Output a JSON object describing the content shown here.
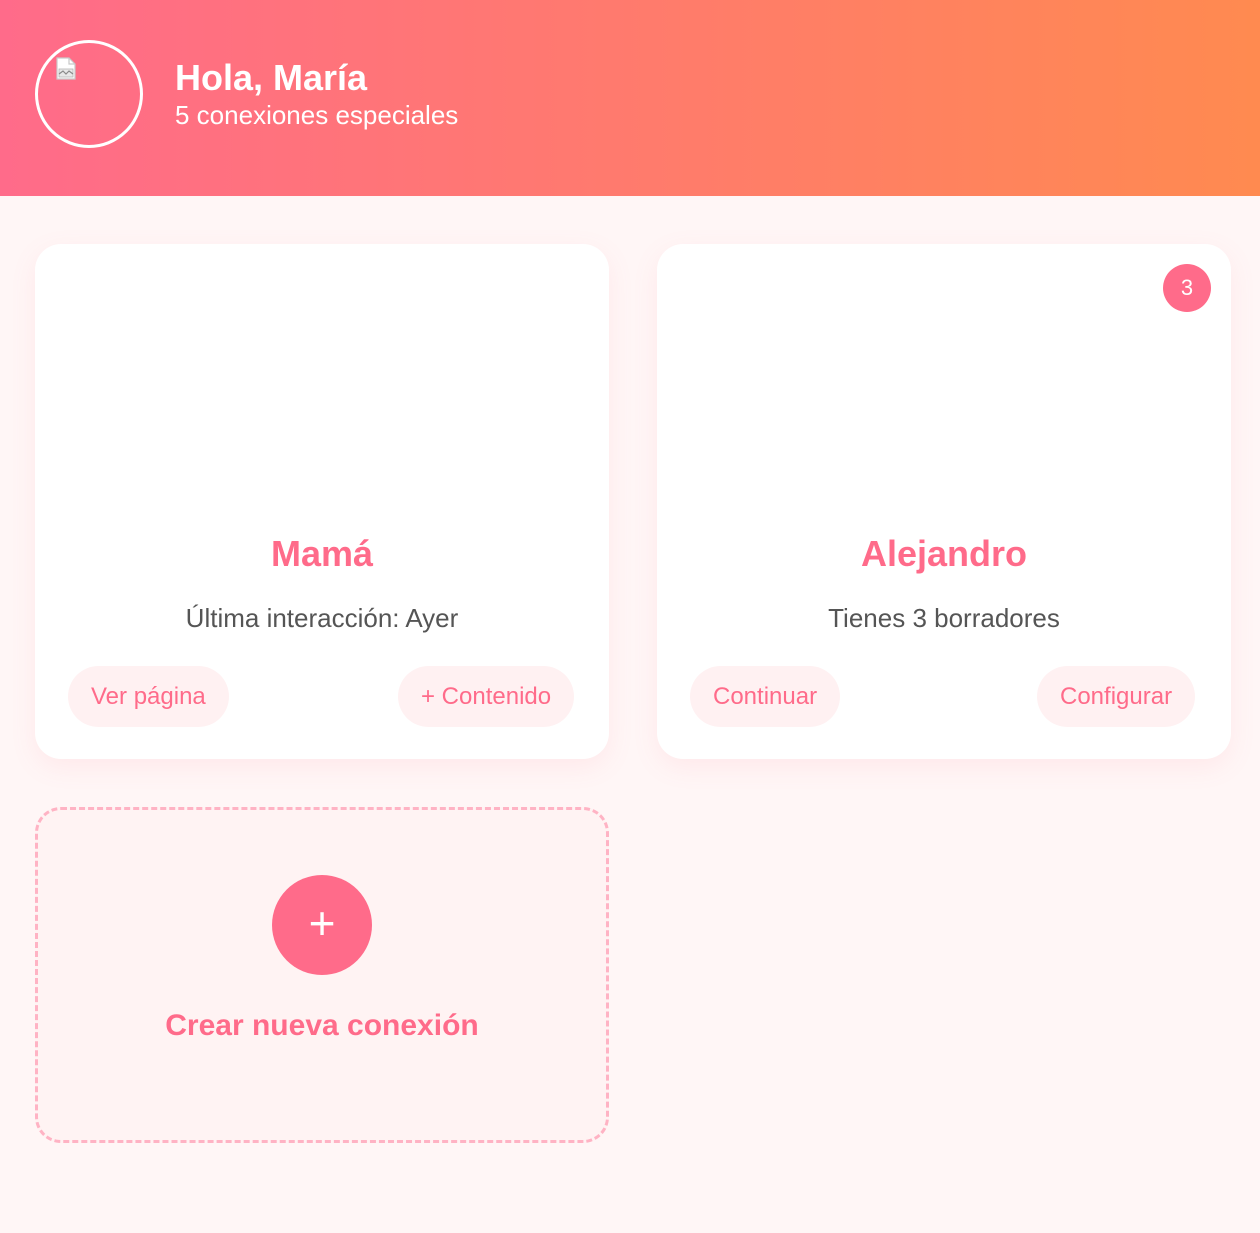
{
  "header": {
    "greeting": "Hola, María",
    "subtitle": "5 conexiones especiales",
    "gradient_start": "#ff6b8a",
    "gradient_end": "#ff8a50",
    "avatar_icon": "broken-image-icon"
  },
  "cards": [
    {
      "name": "Mamá",
      "status": "Última interacción: Ayer",
      "actions": [
        "Ver página",
        "+ Contenido"
      ]
    },
    {
      "name": "Alejandro",
      "status": "Tienes 3 borradores",
      "badge": "3",
      "actions": [
        "Continuar",
        "Configurar"
      ]
    }
  ],
  "new_connection": {
    "plus": "+",
    "label": "Crear nueva conexión"
  },
  "colors": {
    "accent": "#ff6b8a",
    "background": "#fff6f6",
    "pill_background": "#fff1f2",
    "dashed_border": "#ffb3c4"
  }
}
